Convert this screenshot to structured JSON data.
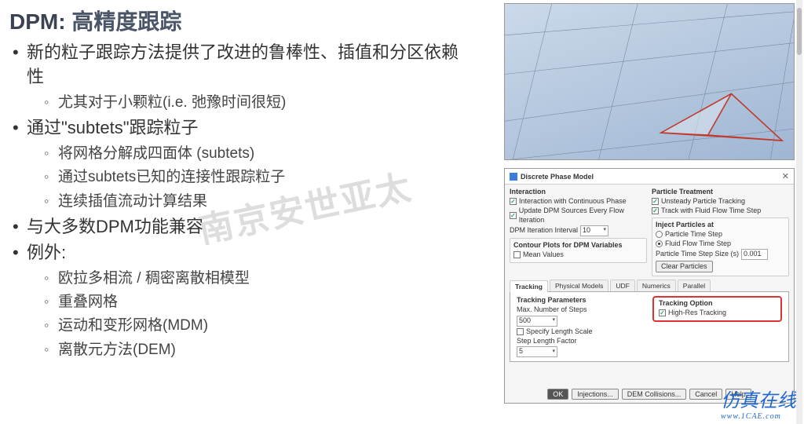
{
  "title": {
    "prefix": "DPM:",
    "rest": " 高精度跟踪"
  },
  "bullets": [
    {
      "t": "新的粒子跟踪方法提供了改进的鲁棒性、插值和分区依赖性",
      "sub": [
        "尤其对于小颗粒(i.e. 弛豫时间很短)"
      ]
    },
    {
      "t": "通过\"subtets\"跟踪粒子",
      "sub": [
        "将网格分解成四面体 (subtets)",
        "通过subtets已知的连接性跟踪粒子",
        "连续插值流动计算结果"
      ]
    },
    {
      "t": "与大多数DPM功能兼容"
    },
    {
      "t": "例外:",
      "sub": [
        "欧拉多相流 / 稠密离散相模型",
        "重叠网格",
        "运动和变形网格(MDM)",
        "离散元方法(DEM)"
      ]
    }
  ],
  "watermark_center": "南京安世亚太",
  "watermark_right": {
    "top": "仿真在线",
    "sub": "www.1CAE.com"
  },
  "dialog": {
    "title": "Discrete Phase Model",
    "interaction": {
      "heading": "Interaction",
      "c1": "Interaction with Continuous Phase",
      "c2": "Update DPM Sources Every Flow Iteration",
      "iter_label": "DPM Iteration Interval",
      "iter_val": "10"
    },
    "treatment": {
      "heading": "Particle Treatment",
      "c1": "Unsteady Particle Tracking",
      "c2": "Track with Fluid Flow Time Step",
      "inject_head": "Inject Particles at",
      "r1": "Particle Time Step",
      "r2": "Fluid Flow Time Step",
      "step_label": "Particle Time Step Size (s)",
      "step_val": "0.001",
      "clear": "Clear Particles"
    },
    "contour": {
      "heading": "Contour Plots for DPM Variables",
      "c1": "Mean Values"
    },
    "tabs": [
      "Tracking",
      "Physical Models",
      "UDF",
      "Numerics",
      "Parallel"
    ],
    "tracking": {
      "heading": "Tracking Parameters",
      "max_label": "Max. Number of Steps",
      "max_val": "500",
      "spec": "Specify Length Scale",
      "slf_label": "Step Length Factor",
      "slf_val": "5",
      "opt_head": "Tracking Option",
      "opt_c": "High-Res Tracking"
    },
    "buttons": {
      "ok": "OK",
      "inj": "Injections...",
      "dem": "DEM Collisions...",
      "cancel": "Cancel",
      "help": "Help"
    }
  }
}
